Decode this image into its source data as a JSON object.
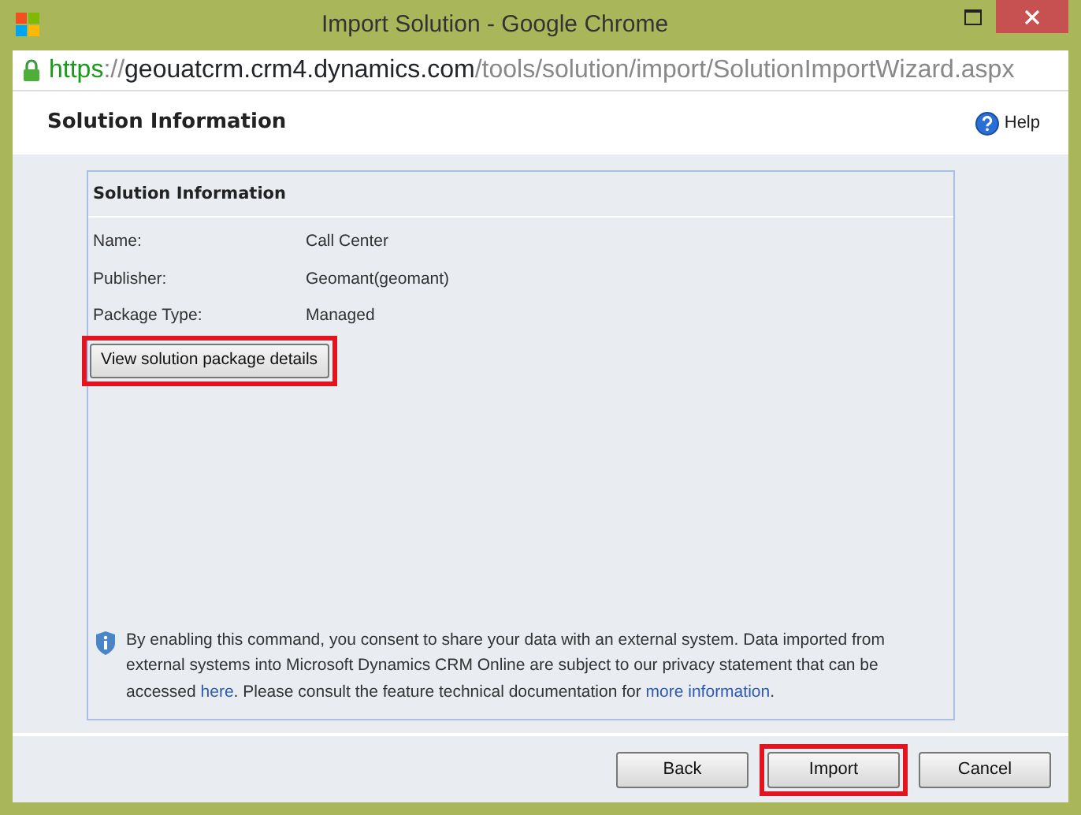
{
  "window": {
    "title": "Import Solution - Google Chrome"
  },
  "address_bar": {
    "scheme": "https",
    "separator": "://",
    "host": "geouatcrm.crm4.dynamics.com",
    "path": "/tools/solution/import/SolutionImportWizard.aspx",
    "secure": true
  },
  "header": {
    "title": "Solution Information",
    "help": "Help"
  },
  "panel": {
    "title": "Solution Information",
    "fields": [
      {
        "label": "Name:",
        "value": "Call Center"
      },
      {
        "label": "Publisher:",
        "value": "Geomant(geomant)"
      },
      {
        "label": "Package Type:",
        "value": "Managed"
      }
    ],
    "details_button": {
      "label": "View solution package details",
      "highlighted": true
    },
    "notice": [
      {
        "kind": "text",
        "text": "By enabling this command, you consent to share your data with an external system. Data imported from external systems into Microsoft Dynamics CRM Online are subject to our privacy statement that can be accessed "
      },
      {
        "kind": "link",
        "text": "here"
      },
      {
        "kind": "text",
        "text": ". Please consult the feature technical documentation for "
      },
      {
        "kind": "link",
        "text": "more information"
      },
      {
        "kind": "text",
        "text": "."
      }
    ]
  },
  "buttons": [
    {
      "label": "Back",
      "highlighted": false
    },
    {
      "label": "Import",
      "highlighted": true
    },
    {
      "label": "Cancel",
      "highlighted": false
    }
  ]
}
